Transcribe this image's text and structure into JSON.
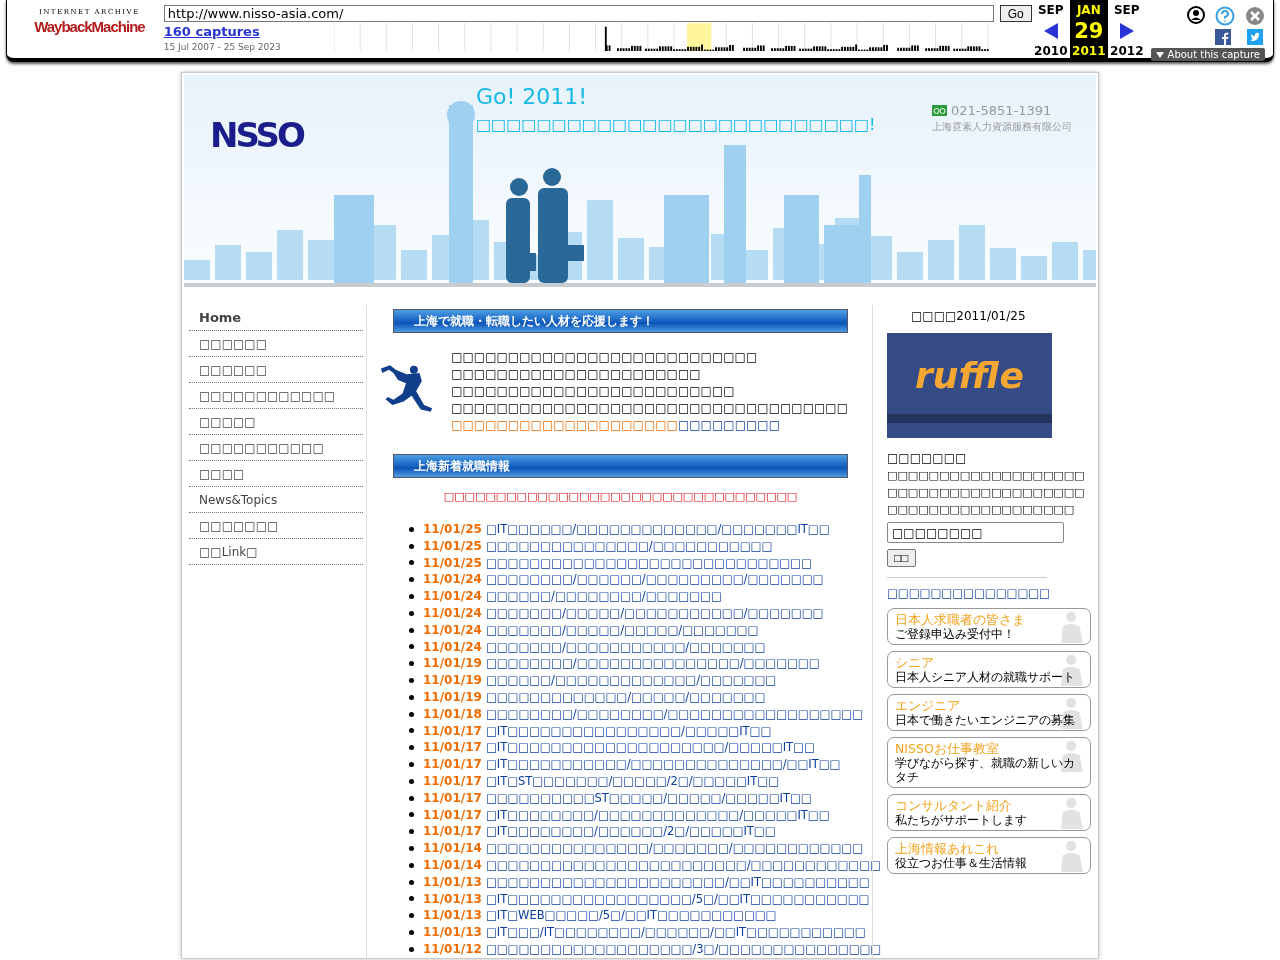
{
  "wayback": {
    "logo_top": "INTERNET ARCHIVE",
    "logo": "WaybackMachine",
    "url": "http://www.nisso-asia.com/",
    "go": "Go",
    "captures": "160 captures",
    "range": "15 Jul 2007 - 25 Sep 2023",
    "months": [
      {
        "month": "SEP",
        "year": "2010",
        "selected": false
      },
      {
        "month": "JAN",
        "year": "2011",
        "day": "29",
        "selected": true
      },
      {
        "month": "SEP",
        "year": "2012",
        "selected": false
      }
    ],
    "about": "About this capture"
  },
  "header": {
    "logo": "NSSO",
    "title": "Go! 2011!",
    "subtitle": "□□□□□□□□□□□□□□□□□□□□□□□□□□!",
    "phone": "021-5851-1391",
    "company": "上海霓素人力資源服務有限公司"
  },
  "nav": [
    {
      "label": "Home",
      "selected": true
    },
    {
      "label": "□□□□□□",
      "selected": false
    },
    {
      "label": "□□□□□□",
      "selected": false
    },
    {
      "label": "□□□□□□□□□□□□",
      "selected": false
    },
    {
      "label": "□□□□□",
      "selected": false
    },
    {
      "label": "□□□□□□□□□□□",
      "selected": false
    },
    {
      "label": "□□□□",
      "selected": false
    },
    {
      "label": "News&Topics",
      "selected": false
    },
    {
      "label": "□□□□□□□",
      "selected": false
    },
    {
      "label": "□□Link□",
      "selected": false
    }
  ],
  "intro": {
    "heading": "上海で就職・転職したい人材を応援します！",
    "lines": [
      "□□□□□□□□□□□□□□□□□□□□□□□□□□□",
      "□□□□□□□□□□□□□□□□□□□□□□",
      "□□□□□□□□□□□□□□□□□□□□□□□□□",
      "□□□□□□□□□□□□□□□□□□□□□□□□□□□□□□□□□□□"
    ],
    "highlight": "□□□□□□□□□□□□□□□□□□□□",
    "link": "□□□□□□□□□"
  },
  "news": {
    "heading": "上海新着就職情報",
    "notice": "□□□□□□□□□□□□□□□□□□□□□□□□□□□□□□□□□□",
    "items": [
      {
        "date": "11/01/25",
        "title": "□IT□□□□□□/□□□□□□□□□□□□□/□□□□□□□IT□□"
      },
      {
        "date": "11/01/25",
        "title": "□□□□□□□□□□□□□□□/□□□□□□□□□□□"
      },
      {
        "date": "11/01/25",
        "title": "□□□□□□□□□□□□□□□□□□□□□□□□□□□□□□"
      },
      {
        "date": "11/01/24",
        "title": "□□□□□□□□/□□□□□□/□□□□□□□□□/□□□□□□□"
      },
      {
        "date": "11/01/24",
        "title": "□□□□□□/□□□□□□□□/□□□□□□□"
      },
      {
        "date": "11/01/24",
        "title": "□□□□□□□/□□□□□/□□□□□□□□□□□/□□□□□□□"
      },
      {
        "date": "11/01/24",
        "title": "□□□□□□□/□□□□□/□□□□□/□□□□□□□"
      },
      {
        "date": "11/01/24",
        "title": "□□□□□□□/□□□□□□□□□□□/□□□□□□□"
      },
      {
        "date": "11/01/19",
        "title": "□□□□□□□□/□□□□□□□□□□□□□□□/□□□□□□□"
      },
      {
        "date": "11/01/19",
        "title": "□□□□□□/□□□□□□□□□□□□□/□□□□□□□"
      },
      {
        "date": "11/01/19",
        "title": "□□□□□□□□□□□□□/□□□□□/□□□□□□□"
      },
      {
        "date": "11/01/18",
        "title": "□□□□□□□□/□□□□□□□□/□□□□□□□□□□□□□□□□□□"
      },
      {
        "date": "11/01/17",
        "title": "□IT□□□□□□□□□□□□□□□□/□□□□□IT□□"
      },
      {
        "date": "11/01/17",
        "title": "□IT□□□□□□□□□□□□□□□□□□□□/□□□□□IT□□"
      },
      {
        "date": "11/01/17",
        "title": "□IT□□□□□□□□□□□/□□□□□□□□□□□□□□/□□IT□□"
      },
      {
        "date": "11/01/17",
        "title": "□IT□ST□□□□□□□/□□□□□/2□/□□□□□IT□□"
      },
      {
        "date": "11/01/17",
        "title": "□□□□□□□□□□ST□□□□□/□□□□□/□□□□□IT□□"
      },
      {
        "date": "11/01/17",
        "title": "□IT□□□□□□□□/□□□□□□□□□□□□□/□□□□□IT□□"
      },
      {
        "date": "11/01/17",
        "title": "□IT□□□□□□□□/□□□□□□/2□/□□□□□IT□□"
      },
      {
        "date": "11/01/14",
        "title": "□□□□□□□□□□□□□□□/□□□□□□□/□□□□□□□□□□□□"
      },
      {
        "date": "11/01/14",
        "title": "□□□□□□□□□□□□□□□□□□□□□□□□/□□□□□□□□□□□□"
      },
      {
        "date": "11/01/13",
        "title": "□□□□□□□□□□□□□□□□□□□□□□/□□IT□□□□□□□□□□"
      },
      {
        "date": "11/01/13",
        "title": "□IT□□□□□□□□□□□□□□□□□/5□/□□IT□□□□□□□□□□□"
      },
      {
        "date": "11/01/13",
        "title": "□IT□WEB□□□□□/5□/□□IT□□□□□□□□□□□"
      },
      {
        "date": "11/01/13",
        "title": "□IT□□□/IT□□□□□□□□/□□□□□□/□□IT□□□□□□□□□□□"
      },
      {
        "date": "11/01/12",
        "title": "□□□□□□□□□□□□□□□□□□□/3□/□□□□□□□□□□□□□□□"
      }
    ]
  },
  "side": {
    "updated": "□□□□2011/01/25",
    "ruffle": "ruffle",
    "text_title": "□□□□□□□",
    "text_lines": [
      "□□□□□□□□□□□□□□□□□□□",
      "□□□□□□□□□□□□□□□□□□□",
      "□□□□□□□□□□□□□□□□□□"
    ],
    "search_value": "□□□□□□□□",
    "search_button": "□□",
    "link": "□□□□□□□□□□□□□□□",
    "banners": [
      {
        "title": "日本人求職者の皆さま",
        "text": "ご登録申込み受付中！"
      },
      {
        "title": "シニア",
        "text": "日本人シニア人材の就職サポート"
      },
      {
        "title": "エンジニア",
        "text": "日本で働きたいエンジニアの募集"
      },
      {
        "title": "NISSOお仕事教室",
        "text": "学びながら探す、就職の新しいカタチ"
      },
      {
        "title": "コンサルタント紹介",
        "text": "私たちがサポートします"
      },
      {
        "title": "上海情報あれこれ",
        "text": "役立つお仕事＆生活情報"
      }
    ]
  }
}
